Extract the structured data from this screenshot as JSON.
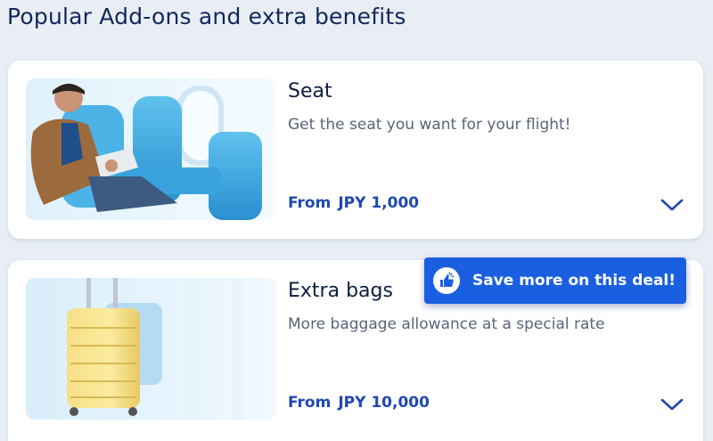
{
  "section": {
    "title": "Popular Add-ons and extra benefits"
  },
  "addons": [
    {
      "title": "Seat",
      "description": "Get the seat you want for your flight!",
      "price_prefix": "From",
      "price": "JPY 1,000",
      "image": "seat-photo"
    },
    {
      "title": "Extra bags",
      "description": "More baggage allowance at a special rate",
      "price_prefix": "From",
      "price": "JPY 10,000",
      "image": "luggage-photo"
    }
  ],
  "deal_badge": {
    "label": "Save more on this deal!",
    "icon": "thumbs-up-icon"
  },
  "colors": {
    "accent": "#1f48b2",
    "badge": "#1a5fe0",
    "title": "#12285b",
    "background": "#e9eef5"
  }
}
